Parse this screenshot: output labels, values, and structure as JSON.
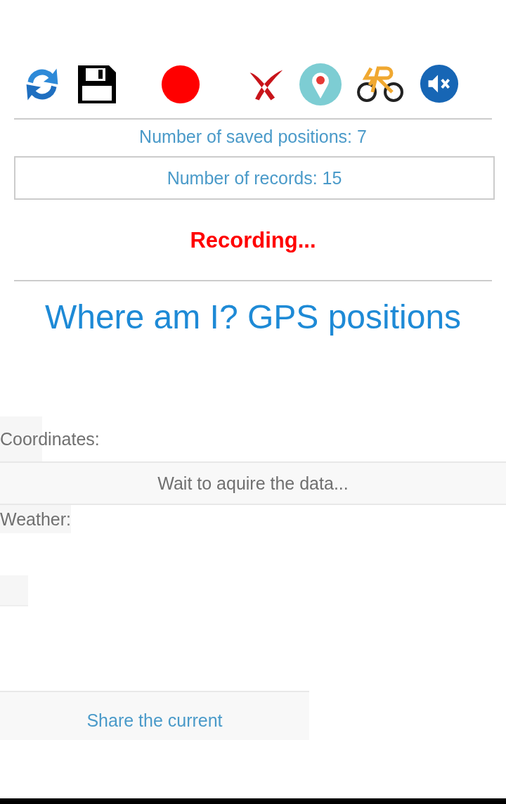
{
  "saved_positions": "Number of saved positions: 7",
  "records": "Number of records: 15",
  "status": "Recording...",
  "heading": "Where am I? GPS positions",
  "coordinates_label": "Coordinates:",
  "coordinates_value": "Wait to aquire the data...",
  "weather_label": "Weather:",
  "share_button": "Share the current"
}
